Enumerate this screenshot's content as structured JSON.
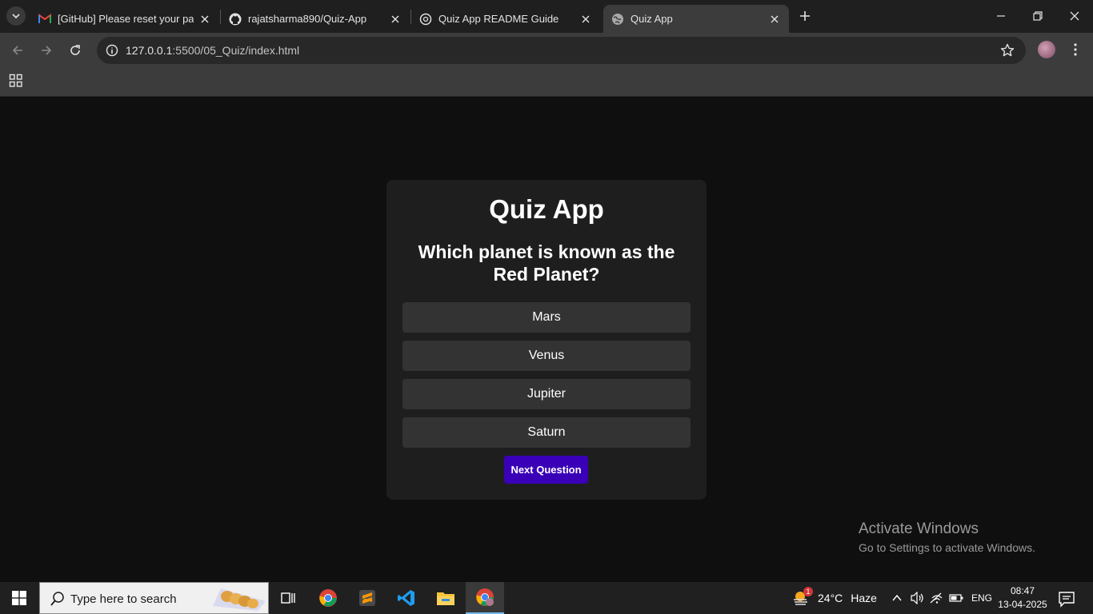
{
  "browser": {
    "tabs": [
      {
        "title": "[GitHub] Please reset your password",
        "favicon": "gmail-icon"
      },
      {
        "title": "rajatsharma890/Quiz-App",
        "favicon": "github-icon"
      },
      {
        "title": "Quiz App README Guide",
        "favicon": "openai-icon"
      },
      {
        "title": "Quiz App",
        "favicon": "globe-icon",
        "active": true
      }
    ],
    "url_host": "127.0.0.1",
    "url_path": ":5500/05_Quiz/index.html"
  },
  "quiz": {
    "title": "Quiz App",
    "question": "Which planet is known as the Red Planet?",
    "answers": [
      "Mars",
      "Venus",
      "Jupiter",
      "Saturn"
    ],
    "next_label": "Next Question",
    "next_color": "#3a00b8"
  },
  "watermark": {
    "line1": "Activate Windows",
    "line2": "Go to Settings to activate Windows."
  },
  "taskbar": {
    "search_placeholder": "Type here to search",
    "weather": "24°C",
    "weather_desc": "Haze",
    "weather_badge": "1",
    "language": "ENG",
    "time": "08:47",
    "date": "13-04-2025"
  }
}
